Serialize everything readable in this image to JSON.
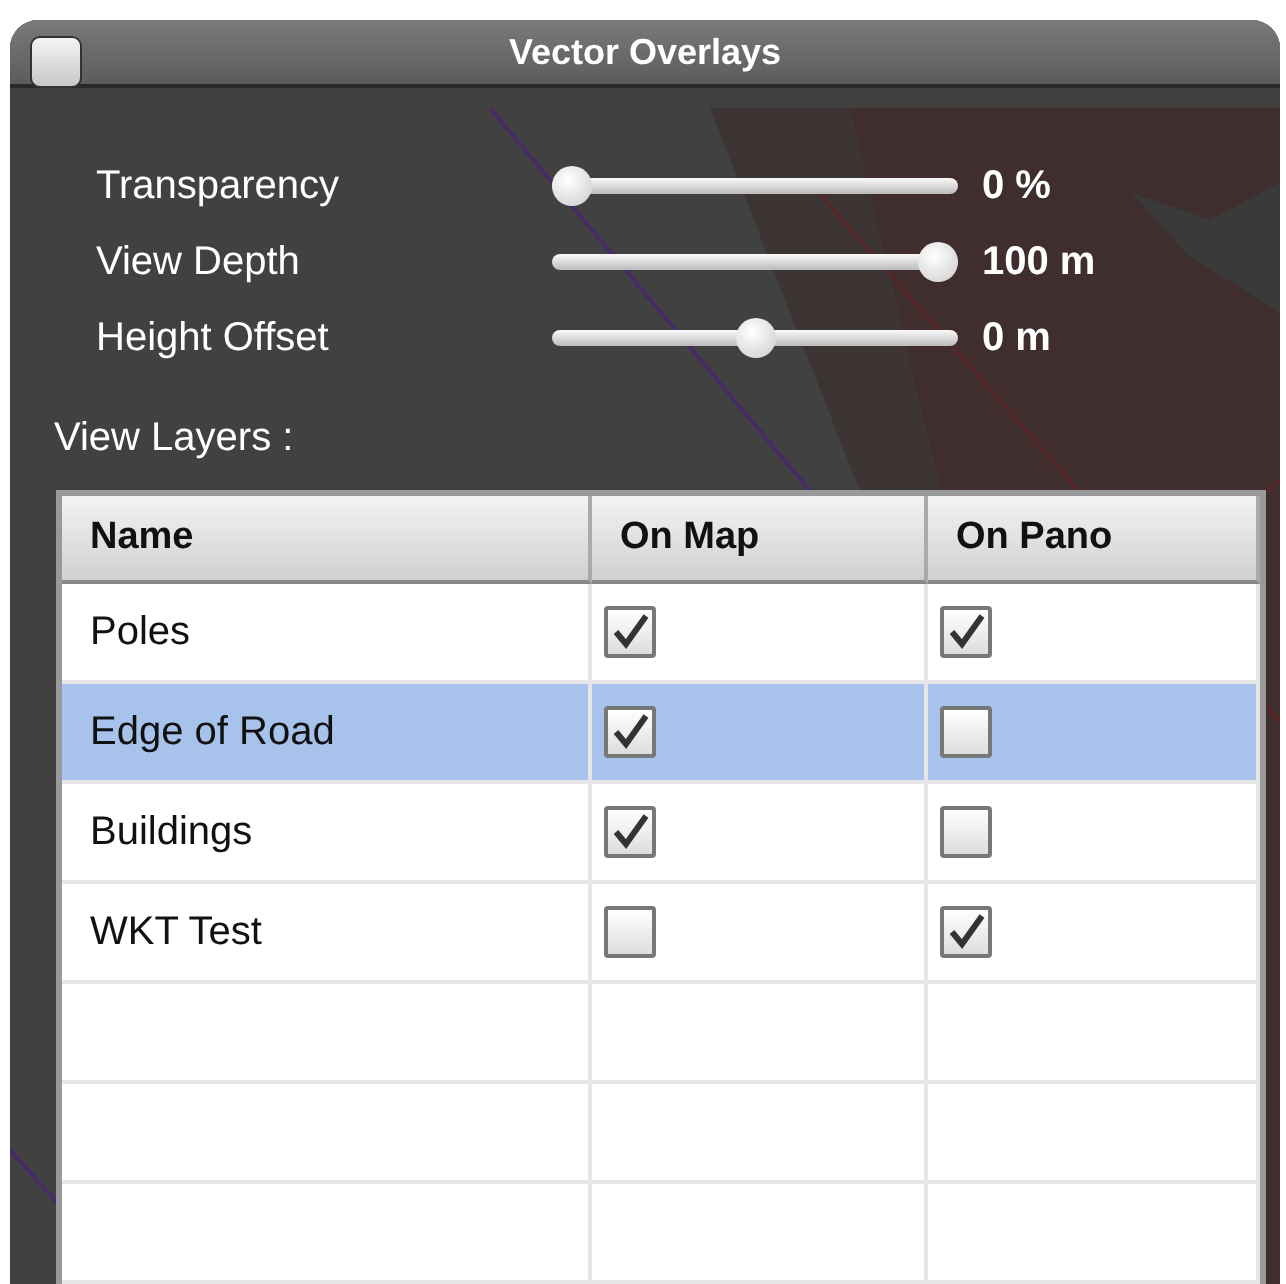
{
  "window": {
    "title": "Vector Overlays"
  },
  "sliders": [
    {
      "label": "Transparency",
      "level": 0,
      "reading": "0 %"
    },
    {
      "label": "View Depth",
      "level": 1,
      "reading": "100 m"
    },
    {
      "label": "Height Offset",
      "level": 0.5,
      "reading": "0 m"
    }
  ],
  "layers": {
    "label": "View Layers :",
    "columns": [
      "Name",
      "On Map",
      "On Pano"
    ],
    "rows": [
      {
        "name": "Poles",
        "on_map": true,
        "on_pano": true,
        "selected": false
      },
      {
        "name": "Edge of Road",
        "on_map": true,
        "on_pano": false,
        "selected": true
      },
      {
        "name": "Buildings",
        "on_map": true,
        "on_pano": false,
        "selected": false
      },
      {
        "name": "WKT Test",
        "on_map": false,
        "on_pano": true,
        "selected": false
      }
    ]
  }
}
